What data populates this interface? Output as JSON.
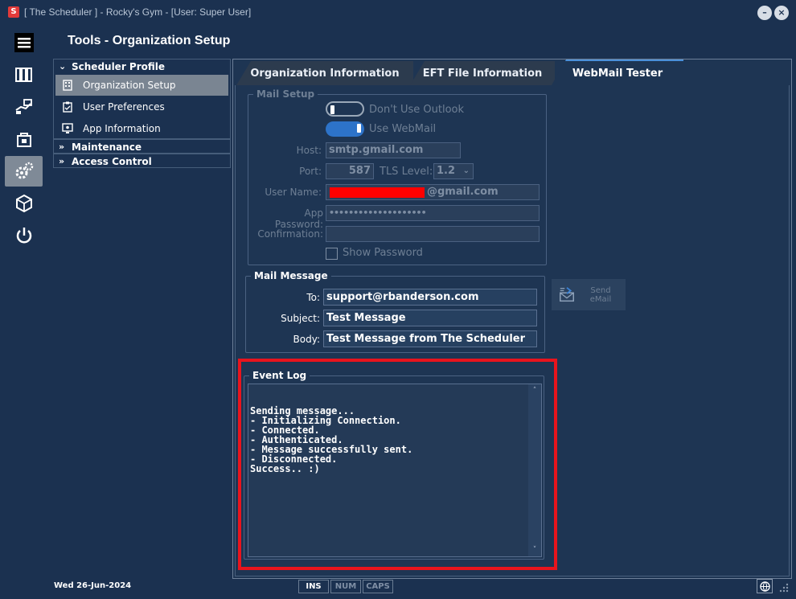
{
  "window": {
    "title": "[ The Scheduler ] - Rocky's Gym - [User: Super User]",
    "logo": "S",
    "minimize": "–",
    "close": "×"
  },
  "page": {
    "title": "Tools - Organization Setup"
  },
  "nav": {
    "groups": [
      {
        "label": "Scheduler Profile",
        "expanded": true,
        "items": [
          {
            "label": "Organization Setup",
            "selected": true,
            "icon": "building-icon"
          },
          {
            "label": "User Preferences",
            "icon": "clipboard-icon"
          },
          {
            "label": "App Information",
            "icon": "monitor-icon"
          }
        ]
      },
      {
        "label": "Maintenance",
        "expanded": false
      },
      {
        "label": "Access Control",
        "expanded": false
      }
    ]
  },
  "tabs": [
    {
      "label": "Organization Information",
      "active": false
    },
    {
      "label": "EFT File Information",
      "active": false
    },
    {
      "label": "WebMail Tester",
      "active": true
    }
  ],
  "mail_setup": {
    "legend": "Mail Setup",
    "dont_use_outlook": "Don't Use Outlook",
    "use_webmail": "Use WebMail",
    "host_label": "Host:",
    "host_value": "smtp.gmail.com",
    "port_label": "Port:",
    "port_value": "587",
    "tls_label": "TLS Level:",
    "tls_value": "1.2",
    "username_label": "User Name:",
    "username_value": "@gmail.com",
    "app_password_label": "App Password:",
    "app_password_value": "••••••••••••••••••••",
    "confirmation_label": "Confirmation:",
    "confirmation_value": "",
    "show_password": "Show Password"
  },
  "mail_message": {
    "legend": "Mail Message",
    "to_label": "To:",
    "to_value": "support@rbanderson.com",
    "subject_label": "Subject:",
    "subject_value": "Test Message",
    "body_label": "Body:",
    "body_value": "Test Message from The Scheduler",
    "send_button": "Send\neMail"
  },
  "event_log": {
    "legend": "Event Log",
    "lines": "Sending message...\n- Initializing Connection.\n- Connected.\n- Authenticated.\n- Message successfully sent.\n- Disconnected.\nSuccess.. :)"
  },
  "status_bar": {
    "date": "Wed  26-Jun-2024",
    "ins": "INS",
    "num": "NUM",
    "caps": "CAPS"
  },
  "colors": {
    "background": "#1b3150",
    "accent": "#2d73c9",
    "highlight": "#e8141d",
    "redaction": "#ff0000"
  }
}
